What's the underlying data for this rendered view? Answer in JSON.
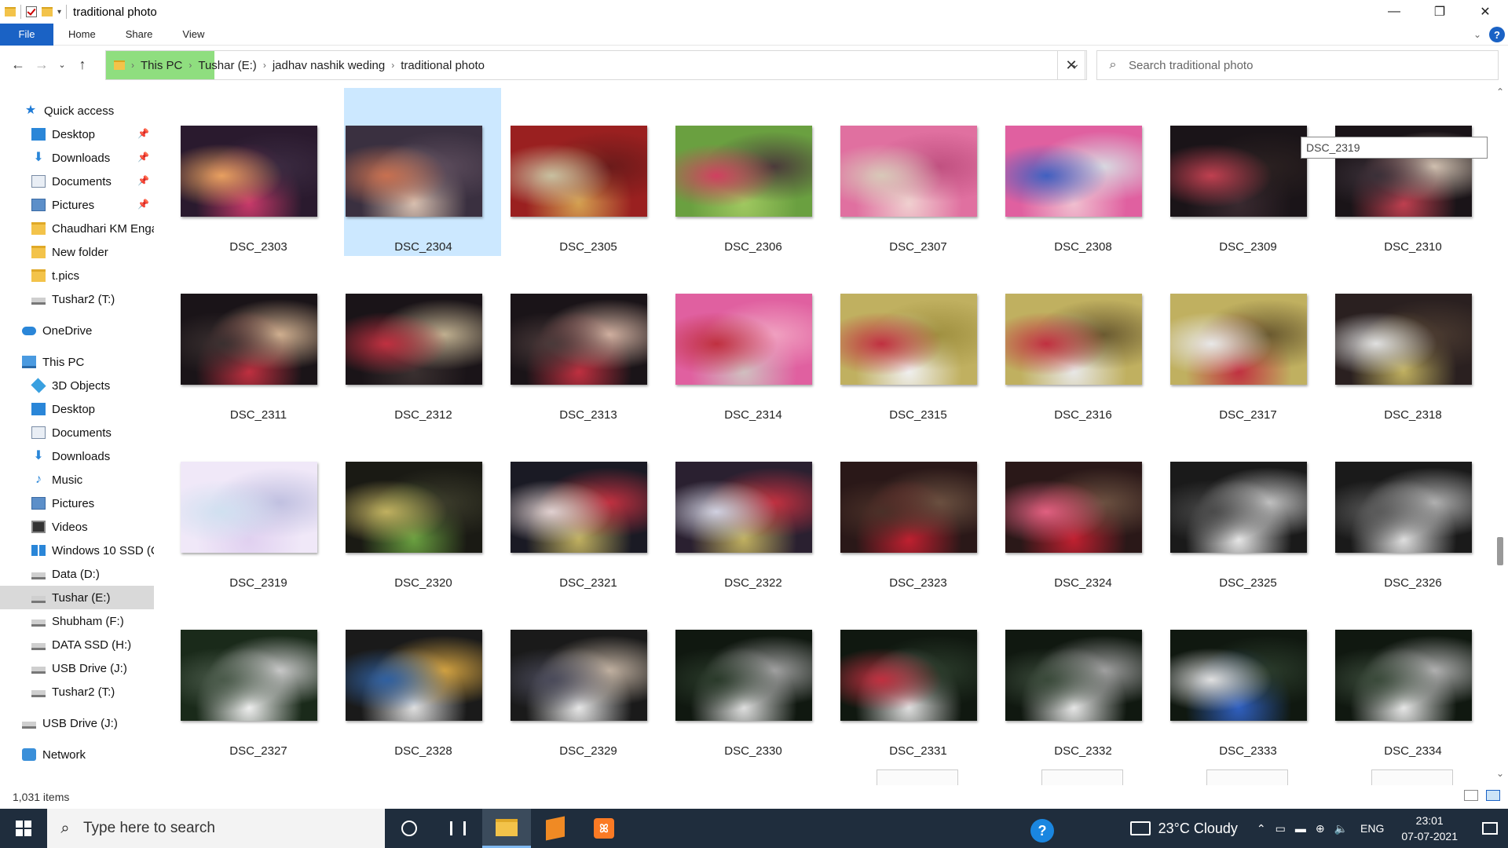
{
  "window": {
    "title": "traditional photo",
    "controls": [
      "minimize-icon",
      "maximize-icon",
      "close-icon"
    ]
  },
  "ribbon": {
    "tabs": [
      "File",
      "Home",
      "Share",
      "View"
    ]
  },
  "address": {
    "crumbs": [
      "This PC",
      "Tushar (E:)",
      "jadhav nashik weding",
      "traditional photo"
    ],
    "search_placeholder": "Search traditional photo"
  },
  "nav": {
    "items": [
      {
        "label": "Quick access",
        "icon": "star-icon",
        "pinned": false
      },
      {
        "label": "Desktop",
        "icon": "desktop-icon",
        "pinned": true
      },
      {
        "label": "Downloads",
        "icon": "downloads-icon",
        "pinned": true
      },
      {
        "label": "Documents",
        "icon": "documents-icon",
        "pinned": true
      },
      {
        "label": "Pictures",
        "icon": "pictures-icon",
        "pinned": true
      },
      {
        "label": "Chaudhari KM Enga",
        "icon": "folder-icon",
        "pinned": false
      },
      {
        "label": "New folder",
        "icon": "folder-icon",
        "pinned": false
      },
      {
        "label": "t.pics",
        "icon": "folder-icon",
        "pinned": false
      },
      {
        "label": "Tushar2 (T:)",
        "icon": "drive-icon",
        "pinned": false
      },
      {
        "label": "OneDrive",
        "icon": "onedrive-icon",
        "pinned": false
      },
      {
        "label": "This PC",
        "icon": "this-pc-icon",
        "pinned": false
      },
      {
        "label": "3D Objects",
        "icon": "3d-objects-icon",
        "pinned": false
      },
      {
        "label": "Desktop",
        "icon": "desktop-icon",
        "pinned": false
      },
      {
        "label": "Documents",
        "icon": "documents-icon",
        "pinned": false
      },
      {
        "label": "Downloads",
        "icon": "downloads-icon",
        "pinned": false
      },
      {
        "label": "Music",
        "icon": "music-icon",
        "pinned": false
      },
      {
        "label": "Pictures",
        "icon": "pictures-icon",
        "pinned": false
      },
      {
        "label": "Videos",
        "icon": "videos-icon",
        "pinned": false
      },
      {
        "label": "Windows 10 SSD (C",
        "icon": "windows-drive-icon",
        "pinned": false
      },
      {
        "label": "Data (D:)",
        "icon": "drive-icon",
        "pinned": false
      },
      {
        "label": "Tushar (E:)",
        "icon": "drive-icon",
        "pinned": false,
        "selected": true
      },
      {
        "label": "Shubham (F:)",
        "icon": "drive-icon",
        "pinned": false
      },
      {
        "label": "DATA SSD (H:)",
        "icon": "drive-icon",
        "pinned": false
      },
      {
        "label": "USB Drive (J:)",
        "icon": "drive-icon",
        "pinned": false
      },
      {
        "label": "Tushar2 (T:)",
        "icon": "drive-icon",
        "pinned": false
      },
      {
        "label": "USB Drive (J:)",
        "icon": "drive-icon",
        "pinned": false
      },
      {
        "label": "Network",
        "icon": "network-icon",
        "pinned": false
      }
    ]
  },
  "files": [
    {
      "name": "DSC_2303",
      "palette": [
        "#2a1a2e",
        "#c83a6a",
        "#e8a060",
        "#3a2a40"
      ]
    },
    {
      "name": "DSC_2304",
      "palette": [
        "#3a3040",
        "#d8c0b0",
        "#c87050",
        "#5a4a5a"
      ],
      "selected": true
    },
    {
      "name": "DSC_2305",
      "palette": [
        "#9a2020",
        "#d4a050",
        "#c8c0a0",
        "#6a1a1a"
      ]
    },
    {
      "name": "DSC_2306",
      "palette": [
        "#6aa040",
        "#a0c860",
        "#d04060",
        "#4a3a3a"
      ]
    },
    {
      "name": "DSC_2307",
      "palette": [
        "#e070a0",
        "#f0d0d0",
        "#d8c8b8",
        "#c05080"
      ]
    },
    {
      "name": "DSC_2308",
      "palette": [
        "#e060a0",
        "#f0c0d0",
        "#4060c0",
        "#d8d8e0"
      ]
    },
    {
      "name": "DSC_2309",
      "palette": [
        "#1a1418",
        "#3a2a30",
        "#c04050",
        "#2a2020"
      ]
    },
    {
      "name": "DSC_2310",
      "palette": [
        "#1a1418",
        "#c04050",
        "#3a3038",
        "#d0c0b0"
      ]
    },
    {
      "name": "DSC_2311",
      "palette": [
        "#1a1418",
        "#c03040",
        "#3a3030",
        "#d0b090"
      ]
    },
    {
      "name": "DSC_2312",
      "palette": [
        "#1a1418",
        "#3a3030",
        "#c03040",
        "#c0b090"
      ]
    },
    {
      "name": "DSC_2313",
      "palette": [
        "#1a1418",
        "#c03040",
        "#4a3a3a",
        "#d0b0a0"
      ]
    },
    {
      "name": "DSC_2314",
      "palette": [
        "#e060a0",
        "#d0c0c0",
        "#c03040",
        "#f0a0c0"
      ]
    },
    {
      "name": "DSC_2315",
      "palette": [
        "#c0b060",
        "#f0f0f0",
        "#c03040",
        "#a09040"
      ]
    },
    {
      "name": "DSC_2316",
      "palette": [
        "#c0b060",
        "#e8e8e8",
        "#c03040",
        "#6a5a30"
      ]
    },
    {
      "name": "DSC_2317",
      "palette": [
        "#c0b060",
        "#c03040",
        "#e8e8e8",
        "#6a5a30"
      ]
    },
    {
      "name": "DSC_2318",
      "palette": [
        "#2a2020",
        "#c0b060",
        "#e0e0e0",
        "#4a3a30"
      ]
    },
    {
      "name": "DSC_2319",
      "palette": [
        "#f0e8f8",
        "#e0d0f0",
        "#d0e0f0",
        "#c0c0e0"
      ]
    },
    {
      "name": "DSC_2320",
      "palette": [
        "#1a1a14",
        "#6aa040",
        "#c0b060",
        "#3a3a2a"
      ]
    },
    {
      "name": "DSC_2321",
      "palette": [
        "#1a1a24",
        "#c0b060",
        "#e0d0d0",
        "#c03040"
      ]
    },
    {
      "name": "DSC_2322",
      "palette": [
        "#2a2030",
        "#c0b060",
        "#d0d0e0",
        "#c03040"
      ]
    },
    {
      "name": "DSC_2323",
      "palette": [
        "#2a1818",
        "#c02030",
        "#4a3028",
        "#6a5040"
      ]
    },
    {
      "name": "DSC_2324",
      "palette": [
        "#2a1818",
        "#c02030",
        "#e06080",
        "#6a5040"
      ]
    },
    {
      "name": "DSC_2325",
      "palette": [
        "#1a1a1a",
        "#e8e8e8",
        "#4a4a4a",
        "#c0c0c0"
      ]
    },
    {
      "name": "DSC_2326",
      "palette": [
        "#1a1a1a",
        "#e0e0e0",
        "#5a5a5a",
        "#b0b0b0"
      ]
    },
    {
      "name": "DSC_2327",
      "palette": [
        "#1a2a1a",
        "#f0f0f0",
        "#4a5a4a",
        "#c8c8c8"
      ]
    },
    {
      "name": "DSC_2328",
      "palette": [
        "#1a1a1a",
        "#e0e0e0",
        "#3060a0",
        "#d0a040"
      ]
    },
    {
      "name": "DSC_2329",
      "palette": [
        "#1a1a1a",
        "#e8e8e8",
        "#4a4a5a",
        "#c0b0a0"
      ]
    },
    {
      "name": "DSC_2330",
      "palette": [
        "#101810",
        "#e0e0e0",
        "#2a3a2a",
        "#a0a0a0"
      ]
    },
    {
      "name": "DSC_2331",
      "palette": [
        "#101810",
        "#e0e0e0",
        "#c03040",
        "#2a3a2a"
      ]
    },
    {
      "name": "DSC_2332",
      "palette": [
        "#101810",
        "#e8e8e8",
        "#3a4a3a",
        "#a0a0a0"
      ]
    },
    {
      "name": "DSC_2333",
      "palette": [
        "#101810",
        "#3060c0",
        "#e0e0e0",
        "#2a3a2a"
      ]
    },
    {
      "name": "DSC_2334",
      "palette": [
        "#101810",
        "#e8e8e8",
        "#3a4a3a",
        "#b0b0b0"
      ]
    }
  ],
  "tooltip": "DSC_2319",
  "status": {
    "item_count": "1,031 items"
  },
  "taskbar": {
    "search_placeholder": "Type here to search",
    "weather": "23°C  Cloudy",
    "language": "ENG",
    "time": "23:01",
    "date": "07-07-2021"
  },
  "colors": {
    "accent": "#1a62c5",
    "selection": "#cce8ff",
    "address_highlight": "#8fde7f",
    "taskbar": "#1f2d3d"
  }
}
